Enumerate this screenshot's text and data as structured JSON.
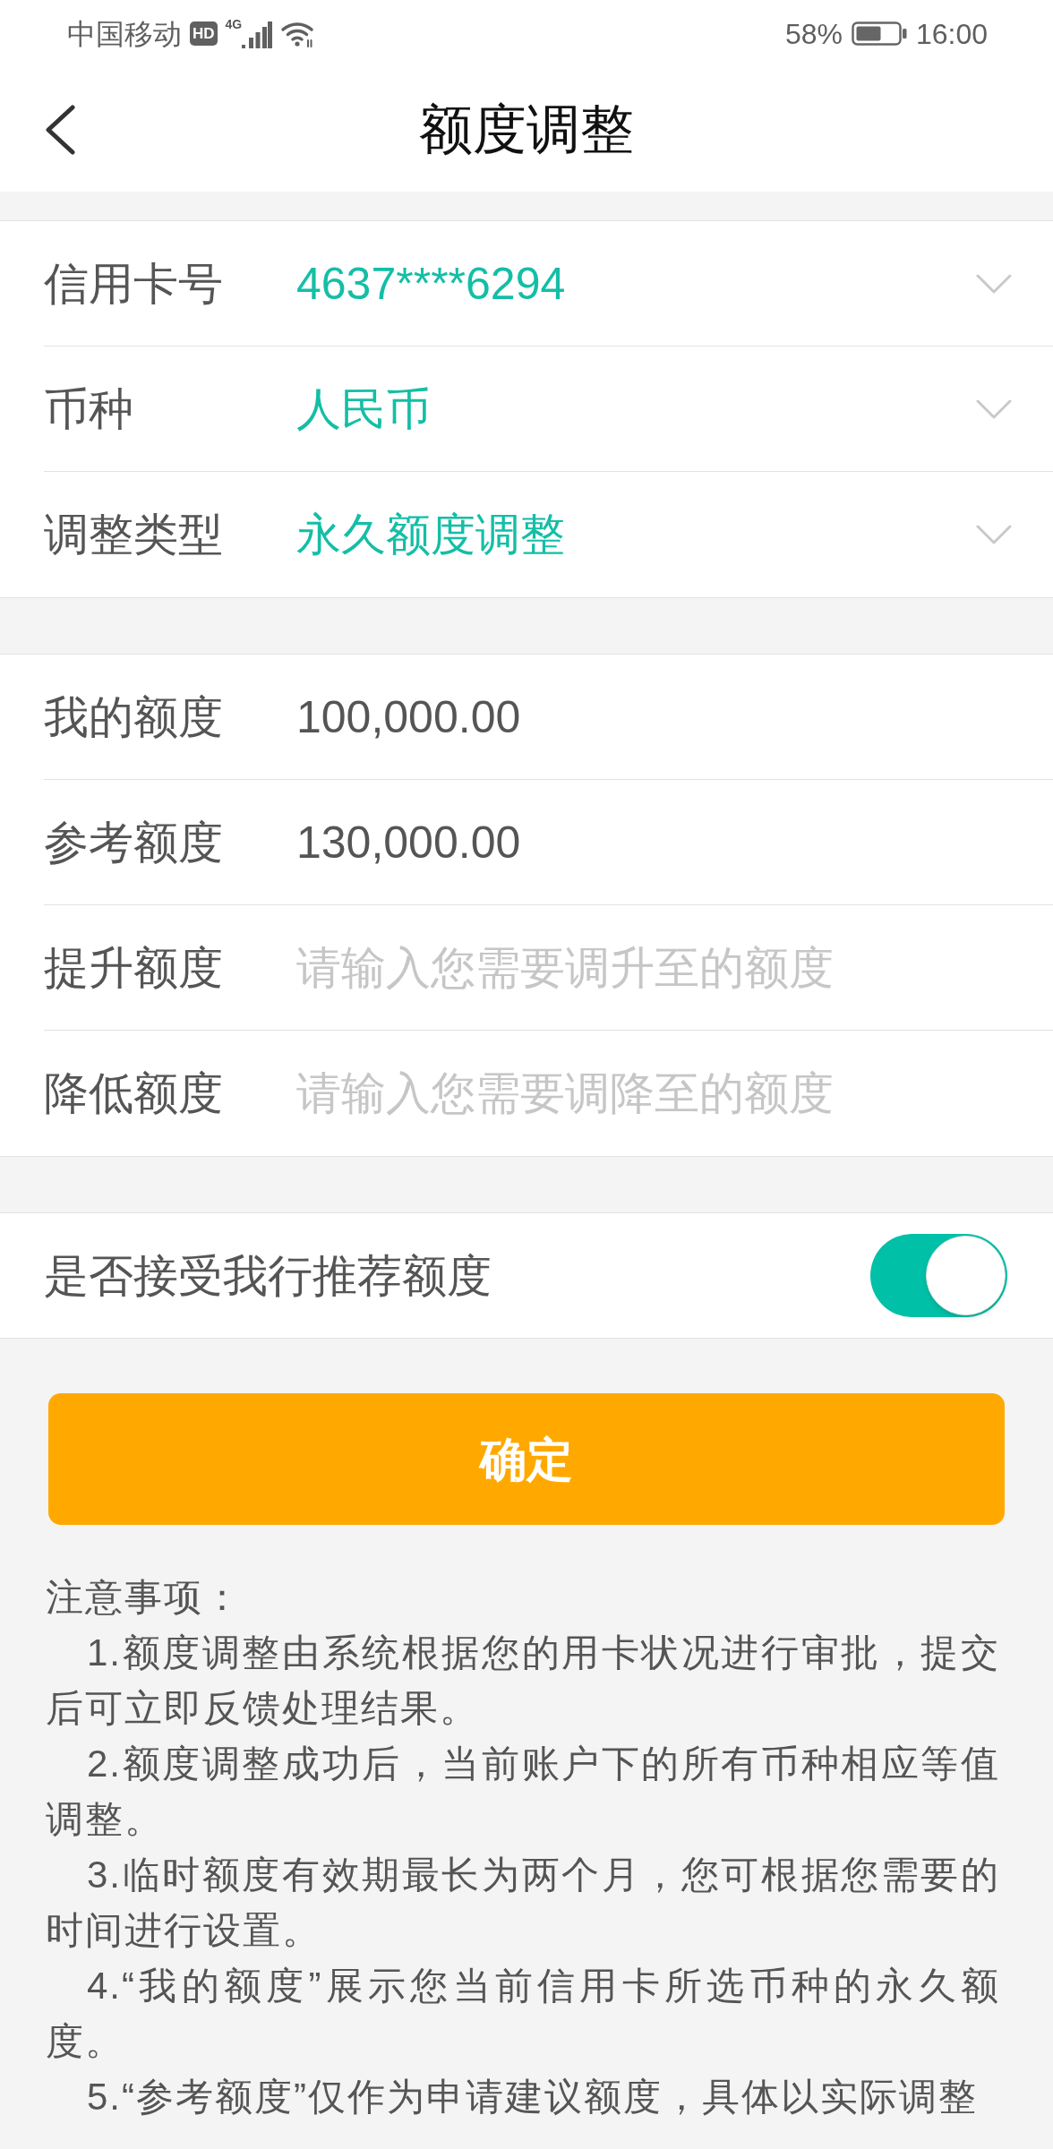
{
  "status_bar": {
    "carrier": "中国移动",
    "hd_badge": "HD",
    "network_type": "4G",
    "battery_percent": "58%",
    "time": "16:00"
  },
  "header": {
    "title": "额度调整"
  },
  "sections": [
    {
      "rows": [
        {
          "kind": "select",
          "label": "信用卡号",
          "value": "4637****6294"
        },
        {
          "kind": "select",
          "label": "币种",
          "value": "人民币"
        },
        {
          "kind": "select",
          "label": "调整类型",
          "value": "永久额度调整"
        }
      ]
    },
    {
      "rows": [
        {
          "kind": "display",
          "label": "我的额度",
          "value": "100,000.00"
        },
        {
          "kind": "display",
          "label": "参考额度",
          "value": "130,000.00"
        },
        {
          "kind": "input",
          "label": "提升额度",
          "placeholder": "请输入您需要调升至的额度"
        },
        {
          "kind": "input",
          "label": "降低额度",
          "placeholder": "请输入您需要调降至的额度"
        }
      ]
    }
  ],
  "recommend": {
    "label": "是否接受我行推荐额度",
    "on": true
  },
  "confirm_button": {
    "label": "确定"
  },
  "notes": {
    "title": "注意事项：",
    "items": [
      "1.额度调整由系统根据您的用卡状况进行审批，提交后可立即反馈处理结果。",
      "2.额度调整成功后，当前账户下的所有币种相应等值调整。",
      "3.临时额度有效期最长为两个月，您可根据您需要的时间进行设置。",
      "4.“我的额度”展示您当前信用卡所选币种的永久额度。",
      "5.“参考额度”仅作为申请建议额度，具体以实际调整"
    ]
  }
}
